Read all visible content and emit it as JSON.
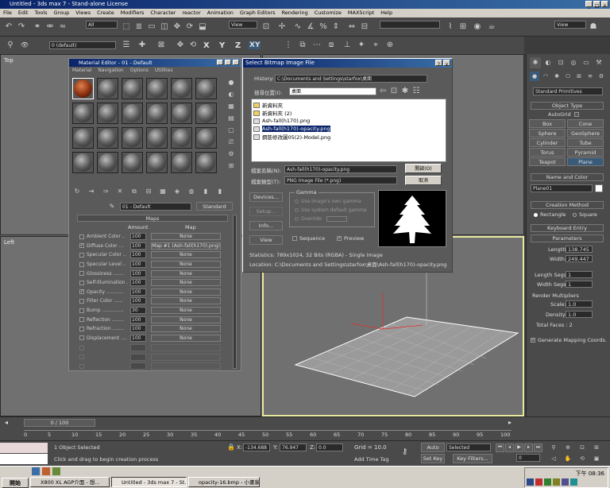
{
  "app": {
    "title": "Untitled - 3ds max 7 - Stand-alone License"
  },
  "menu": [
    "File",
    "Edit",
    "Tools",
    "Group",
    "Views",
    "Create",
    "Modifiers",
    "Character",
    "reactor",
    "Animation",
    "Graph Editors",
    "Rendering",
    "Customize",
    "MAXScript",
    "Help"
  ],
  "toolbar": {
    "selection_filter": "All",
    "layer": "0 (default)",
    "ref_coord": "View",
    "view_dropdown": "View",
    "axis_x": "X",
    "axis_y": "Y",
    "axis_z": "Z",
    "axis_xy": "XY"
  },
  "viewports": {
    "top": "Top",
    "left": "Left"
  },
  "material_editor": {
    "title": "Material Editor - 01 - Default",
    "menu": [
      "Material",
      "Navigation",
      "Options",
      "Utilities"
    ],
    "material_name": "01 - Default",
    "type_button": "Standard",
    "rollout": "Maps",
    "col_amount": "Amount",
    "col_map": "Map",
    "maps": [
      {
        "label": "Ambient Color ..",
        "amount": "100",
        "map": "None",
        "checked": false
      },
      {
        "label": "Diffuse Color ...",
        "amount": "100",
        "map": "Map #1 (Ash-fall(h170).png)",
        "checked": true
      },
      {
        "label": "Specular Color ..",
        "amount": "100",
        "map": "None",
        "checked": false
      },
      {
        "label": "Specular Level ..",
        "amount": "100",
        "map": "None",
        "checked": false
      },
      {
        "label": "Glossiness .......",
        "amount": "100",
        "map": "None",
        "checked": false
      },
      {
        "label": "Self-Illumination .",
        "amount": "100",
        "map": "None",
        "checked": false
      },
      {
        "label": "Opacity ...........",
        "amount": "100",
        "map": "None",
        "checked": true
      },
      {
        "label": "Filter Color ......",
        "amount": "100",
        "map": "None",
        "checked": false
      },
      {
        "label": "Bump ..............",
        "amount": "30",
        "map": "None",
        "checked": false
      },
      {
        "label": "Reflection ........",
        "amount": "100",
        "map": "None",
        "checked": false
      },
      {
        "label": "Refraction ........",
        "amount": "100",
        "map": "None",
        "checked": false
      },
      {
        "label": "Displacement ....",
        "amount": "100",
        "map": "None",
        "checked": false
      }
    ]
  },
  "file_dialog": {
    "title": "Select Bitmap Image File",
    "history_label": "History:",
    "history_path": "C:\\Documents and Settings\\starfox\\桌面",
    "look_in_label": "搜尋位置(I):",
    "look_in": "桌面",
    "files": [
      {
        "name": "新資料夾",
        "kind": "folder"
      },
      {
        "name": "新資料夾 (2)",
        "kind": "folder"
      },
      {
        "name": "Ash-fall(h170).png",
        "kind": "image"
      },
      {
        "name": "Ash-fall(h170)-opacity.png",
        "kind": "image",
        "selected": true
      },
      {
        "name": "鋼筋修改圖05(2)-Model.png",
        "kind": "image"
      }
    ],
    "filename_label": "檔案名稱(N):",
    "filename": "Ash-fall(h170)-opacity.png",
    "filetype_label": "檔案類型(T):",
    "filetype": "PNG Image File (*.png)",
    "open_button": "開啟(O)",
    "cancel_button": "取消",
    "devices": "Devices...",
    "setup": "Setup...",
    "info": "Info...",
    "view": "View",
    "gamma": "Gamma",
    "gamma_opts": [
      "Use image's own gamma",
      "Use system default gamma",
      "Override"
    ],
    "sequence": "Sequence",
    "preview": "Preview",
    "statistics": "Statistics:  789x1024, 32 Bits (RGBA) - Single Image",
    "location": "Location:  C:\\Documents and Settings\\starfox\\桌面\\Ash-fall(h170)-opacity.png"
  },
  "command_panel": {
    "category": "Standard Primitives",
    "object_type": "Object Type",
    "autogrid": "AutoGrid",
    "objects": [
      "Box",
      "Cone",
      "Sphere",
      "GeoSphere",
      "Cylinder",
      "Tube",
      "Torus",
      "Pyramid",
      "Teapot",
      "Plane"
    ],
    "name_color": "Name and Color",
    "name": "Plane01",
    "creation_method": "Creation Method",
    "rectangle": "Rectangle",
    "square": "Square",
    "keyboard_entry": "Keyboard Entry",
    "parameters": "Parameters",
    "length_label": "Length:",
    "length": "138.745",
    "width_label": "Width:",
    "width": "249.447",
    "length_segs_label": "Length Segs:",
    "length_segs": "1",
    "width_segs_label": "Width Segs:",
    "width_segs": "1",
    "render_mult": "Render Multipliers",
    "scale_label": "Scale:",
    "scale": "1.0",
    "density_label": "Density:",
    "density": "1.0",
    "total_faces": "Total Faces : 2",
    "gen_coords": "Generate Mapping Coords."
  },
  "timeline": {
    "frame": "0 / 100",
    "ticks": [
      "0",
      "5",
      "10",
      "15",
      "20",
      "25",
      "30",
      "35",
      "40",
      "45",
      "50",
      "55",
      "60",
      "65",
      "70",
      "75",
      "80",
      "85",
      "90",
      "95",
      "100"
    ]
  },
  "status": {
    "selected": "1 Object Selected",
    "prompt": "Click and drag to begin creation process",
    "x_label": "X:",
    "x": "-134.688",
    "y_label": "Y:",
    "y": "76.947",
    "z_label": "Z:",
    "z": "0.0",
    "grid": "Grid = 10.0",
    "add_time_tag": "Add Time Tag",
    "auto_key": "Auto Key",
    "auto_key_sel": "Selected",
    "set_key": "Set Key",
    "key_filters": "Key Filters...",
    "frame_num": "0"
  },
  "taskbar": {
    "start": "開始",
    "items": [
      "X800 XL AGP介面 - 想...",
      "Untitled - 3ds max 7 - St...",
      "opacity-16.bmp - 小畫家"
    ],
    "clock": "下午 08:36",
    "tray_time": "下午"
  }
}
